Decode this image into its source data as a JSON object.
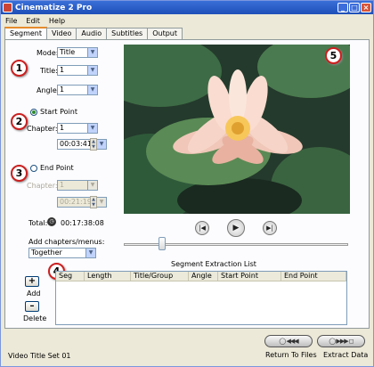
{
  "window": {
    "title": "Cinematize 2 Pro"
  },
  "menu": [
    "File",
    "Edit",
    "Help"
  ],
  "tabs": [
    "Segment",
    "Video",
    "Audio",
    "Subtitles",
    "Output"
  ],
  "callouts": [
    "1",
    "2",
    "3",
    "4",
    "5"
  ],
  "segment": {
    "mode_label": "Mode:",
    "mode_value": "Title",
    "title_label": "Title:",
    "title_value": "1",
    "angle_label": "Angle:",
    "angle_value": "1",
    "start_point_label": "Start Point",
    "start_chapter_label": "Chapter:",
    "start_chapter_value": "1",
    "start_time_value": "00:03:41:05",
    "end_point_label": "End Point",
    "end_chapter_label": "Chapter:",
    "end_chapter_value": "1",
    "end_time_value": "00:21:19:13",
    "total_label": "Total:",
    "total_value": "00:17:38:08",
    "add_chapters_label": "Add chapters/menus:",
    "add_chapters_value": "Together",
    "add_label": "Add",
    "delete_label": "Delete",
    "start_point_selected": true
  },
  "extraction_list": {
    "title": "Segment Extraction List",
    "columns": [
      "Seg",
      "Length",
      "Title/Group",
      "Angle",
      "Start Point",
      "End Point"
    ],
    "rows": []
  },
  "status": {
    "text": "Video Title Set 01",
    "return_label": "Return To Files",
    "extract_label": "Extract Data"
  },
  "colors": {
    "callout_border": "#cc1f1f",
    "title_bar": "#1e4fb8",
    "tab_highlight": "#e68b2c"
  },
  "icons": [
    "app-icon",
    "minimize-icon",
    "maximize-icon",
    "close-icon",
    "clock-icon",
    "skip-back-icon",
    "play-icon",
    "skip-forward-icon",
    "plus-icon",
    "minus-icon",
    "rewind-icon",
    "fast-forward-icon"
  ]
}
